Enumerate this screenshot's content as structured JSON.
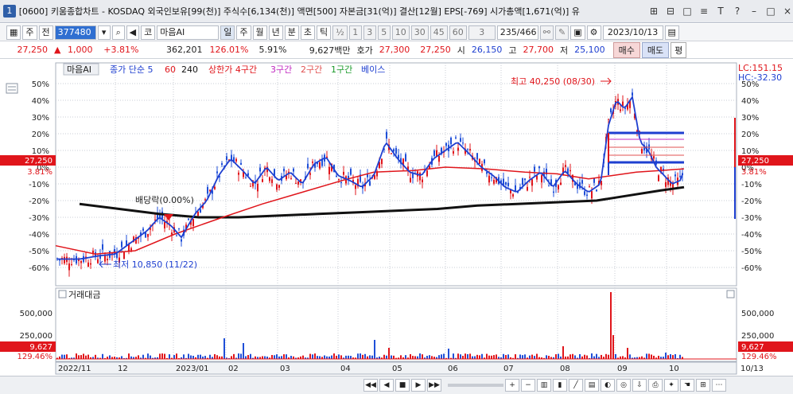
{
  "window": {
    "index": "1",
    "title": "[0600] 키움종합차트 - KOSDAQ 외국인보유[99(천)] 주식수[6,134(천)] 액면[500] 자본금[31(억)] 결산[12월] EPS[-769] 시가총액[1,671(억)] 유",
    "controls": [
      "⊞",
      "⊟",
      "□",
      "≡",
      "T",
      "?",
      "–",
      "□",
      "×"
    ]
  },
  "toolbar": {
    "market": "주",
    "type": "전",
    "code": "377480",
    "stock_name": "마음AI",
    "market_prefix": "코",
    "periods": [
      "일",
      "주",
      "월",
      "년",
      "분",
      "초",
      "틱"
    ],
    "fraction": "½",
    "minutes": [
      "1",
      "3",
      "5",
      "10",
      "30",
      "45",
      "60"
    ],
    "selected_minute": "3",
    "count": "235/466",
    "date": "2023/10/13"
  },
  "price": {
    "current": "27,250",
    "change": "1,000",
    "change_pct": "+3.81%",
    "volume": "362,201",
    "volume_ratio": "126.01%",
    "turnover": "5.91%",
    "amount": "9,627백만",
    "quote_label": "호가",
    "bid": "27,300",
    "ask": "27,250",
    "open_label": "시",
    "open": "26,150",
    "high_label": "고",
    "high": "27,700",
    "low_label": "저",
    "low": "25,100",
    "buy": "매수",
    "sell": "매도",
    "pyeong": "평"
  },
  "chart": {
    "legend": {
      "name": "마음AI",
      "ma_label": "종가 단순 5",
      "ma60": "60",
      "ma240": "240",
      "limit": "상한가 4구간",
      "seg3": "3구간",
      "seg2": "2구간",
      "seg1": "1구간",
      "base": "베이스"
    },
    "lc": "LC:151.15",
    "hc": "HC:-32.30",
    "price_axis": [
      "50%",
      "40%",
      "30%",
      "20%",
      "10%",
      "0%",
      "-10%",
      "-20%",
      "-30%",
      "-40%",
      "-50%",
      "-60%"
    ],
    "current_tag": "27,250",
    "current_pct": "3.81%",
    "annotations": {
      "high": "최고 40,250 (08/30)",
      "dividend": "배당락(0.00%)",
      "low": "최저 10,850 (11/22)"
    }
  },
  "volume": {
    "title": "거래대금",
    "axis": [
      "500,000",
      "250,000"
    ],
    "current_tag": "9,627",
    "current_pct": "129.46%"
  },
  "x_axis": [
    "2022/11",
    "12",
    "2023/01",
    "02",
    "03",
    "04",
    "05",
    "06",
    "07",
    "08",
    "09",
    "10",
    "10/13"
  ],
  "colors": {
    "up": "#e0151b",
    "down": "#1f4fd8",
    "ma5": "#1e3fd0",
    "ma60": "#e0151b",
    "ma240": "#111111",
    "limit": "#e0151b",
    "seg3": "#c028c0",
    "seg2": "#e05050",
    "seg1": "#1a9a2a",
    "base": "#1e3fd0"
  }
}
